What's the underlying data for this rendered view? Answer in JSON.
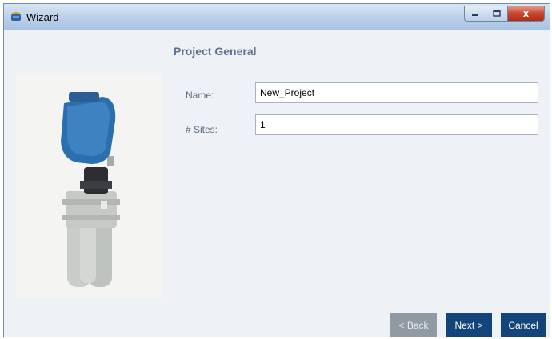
{
  "window": {
    "title": "Wizard",
    "close_glyph": "x"
  },
  "section": {
    "title": "Project General"
  },
  "form": {
    "name_label": "Name:",
    "name_value": "New_Project",
    "sites_label": "# Sites:",
    "sites_value": "1"
  },
  "buttons": {
    "back": "< Back",
    "next": "Next >",
    "cancel": "Cancel"
  },
  "image": {
    "subject": "ultrasonic-level-sensor"
  },
  "colors": {
    "primary_button": "#14457a",
    "disabled_button": "#8f9aa5",
    "section_title": "#5d7390"
  }
}
